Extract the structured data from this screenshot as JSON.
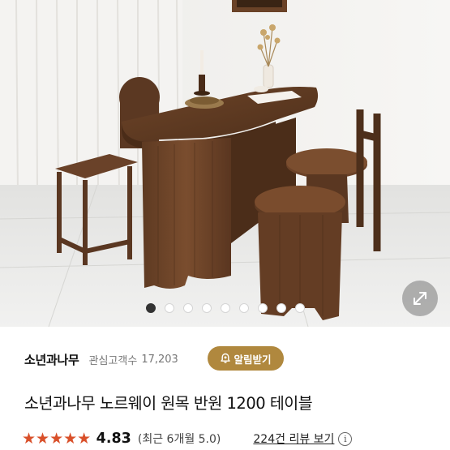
{
  "product_image": {
    "icon": "expand-arrows-icon",
    "carousel_total": 9,
    "carousel_active": 1
  },
  "store": {
    "name": "소년과나무",
    "fan_label": "관심고객수",
    "fan_count": "17,203",
    "alarm_label": "알림받기",
    "alarm_color": "#b0883e"
  },
  "product": {
    "title": "소년과나무 노르웨이 원목 반원 1200 테이블"
  },
  "rating": {
    "stars": "★★★★★",
    "star_color": "#d9502a",
    "score": "4.83",
    "recent": "(최근 6개월 5.0)",
    "review_link": "224건 리뷰 보기",
    "info_icon": "i"
  }
}
